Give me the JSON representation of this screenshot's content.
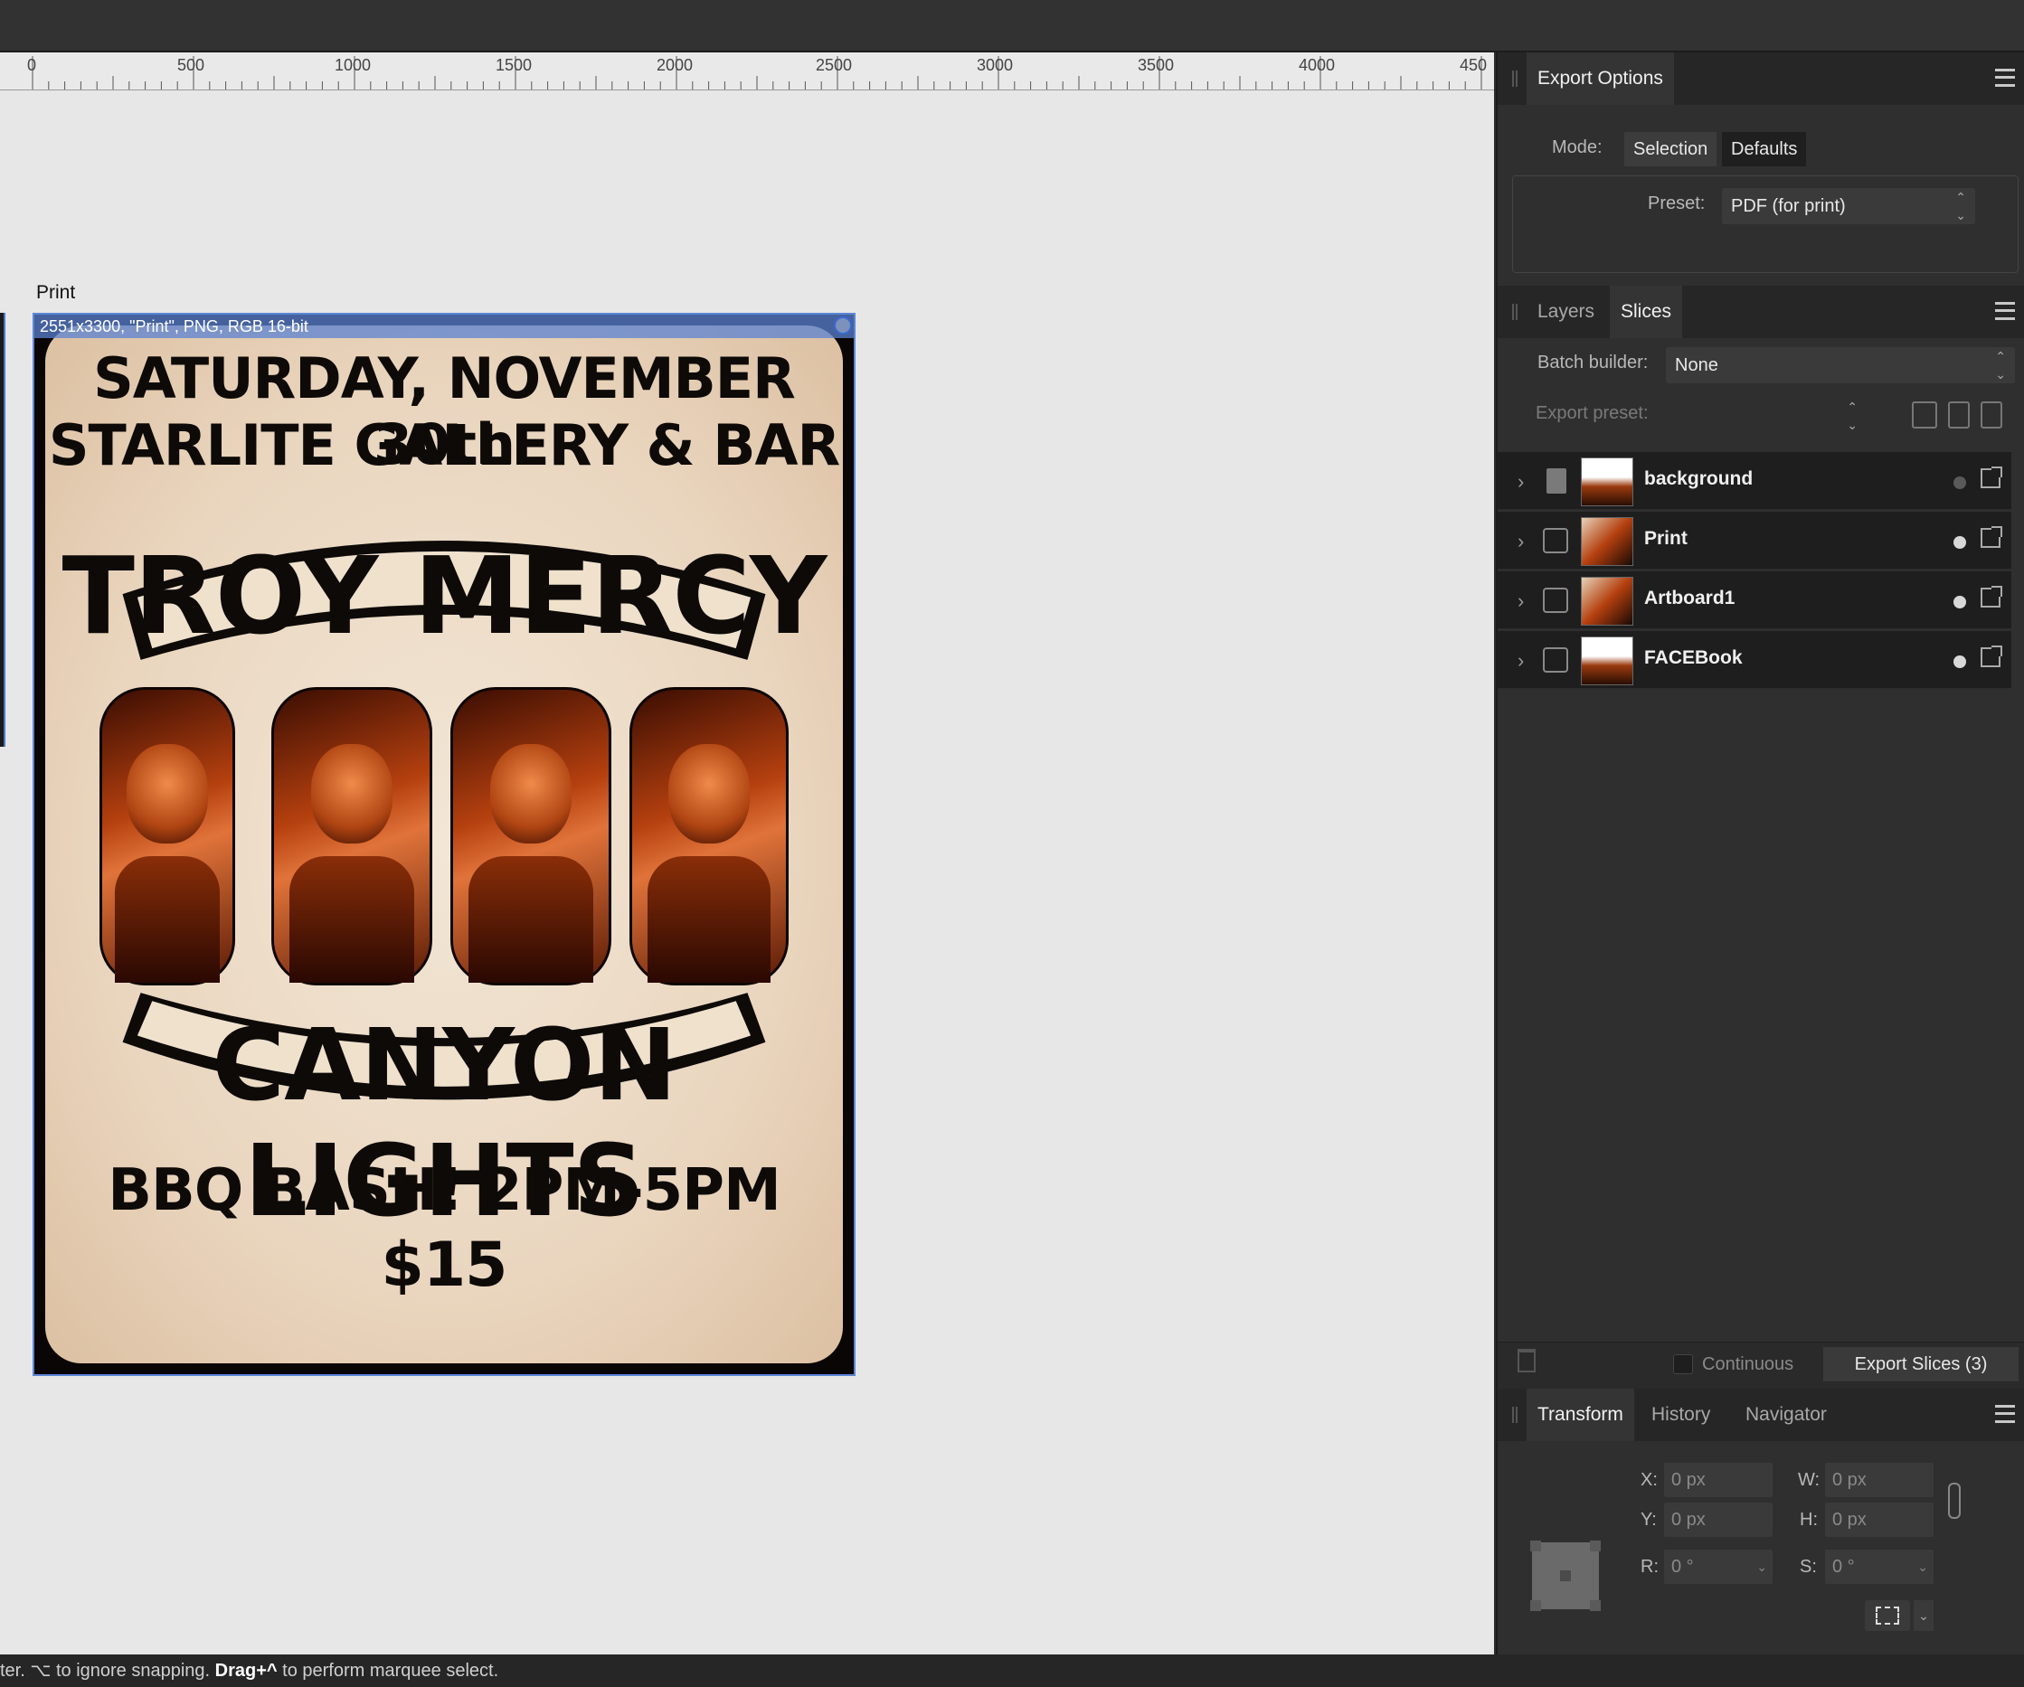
{
  "ruler": {
    "labels": [
      "0",
      "500",
      "1000",
      "1500",
      "2000",
      "2500",
      "3000",
      "3500",
      "4000",
      "450"
    ]
  },
  "canvas": {
    "artboard_title": "Print",
    "slice_label": "2551x3300, \"Print\", PNG, RGB 16-bit"
  },
  "poster": {
    "line1": "SATURDAY, NOVEMBER 30th",
    "line2": "STARLITE GALLERY & BAR",
    "band_top": "TROY MERCY",
    "band_bottom": "CANYON LIGHTS",
    "event": "BBQ BASH! 2PM-5PM",
    "price": "$15"
  },
  "export_options": {
    "tab": "Export Options",
    "mode_label": "Mode:",
    "mode_selection": "Selection",
    "mode_defaults": "Defaults",
    "preset_label": "Preset:",
    "preset_value": "PDF (for print)"
  },
  "slices_panel": {
    "tabs": [
      "Layers",
      "Slices"
    ],
    "batch_label": "Batch builder:",
    "batch_value": "None",
    "export_preset_label": "Export preset:",
    "export_preset_value": "",
    "items": [
      {
        "name": "background"
      },
      {
        "name": "Print"
      },
      {
        "name": "Artboard1"
      },
      {
        "name": "FACEBook"
      }
    ],
    "continuous_label": "Continuous",
    "export_button": "Export Slices (3)"
  },
  "transform_panel": {
    "tabs": [
      "Transform",
      "History",
      "Navigator"
    ],
    "x_label": "X:",
    "x_value": "0 px",
    "y_label": "Y:",
    "y_value": "0 px",
    "w_label": "W:",
    "w_value": "0 px",
    "h_label": "H:",
    "h_value": "0 px",
    "r_label": "R:",
    "r_value": "0 °",
    "s_label": "S:",
    "s_value": "0 °"
  },
  "status": {
    "part1": "ter. ⌥ to ignore snapping. ",
    "bold1": "Drag+^",
    "part2": " to perform marquee select."
  },
  "colors": {
    "accent": "#5a86d6",
    "panel_bg": "#2f2f2f",
    "canvas_bg": "#e7e7e7"
  }
}
